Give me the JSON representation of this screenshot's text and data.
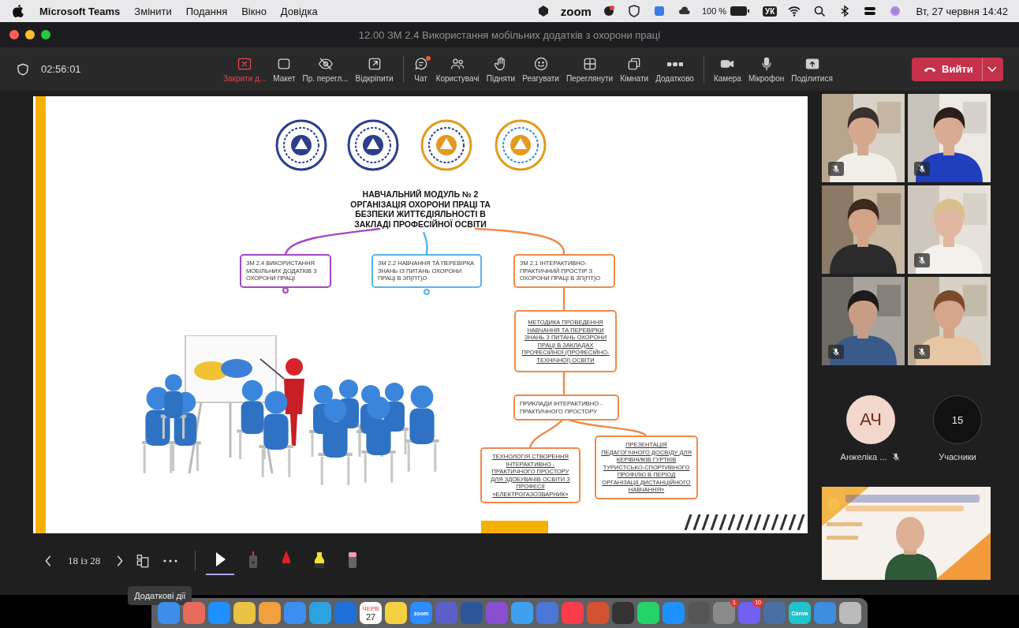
{
  "menu_bar": {
    "app": "Microsoft Teams",
    "menus": [
      "Змінити",
      "Подання",
      "Вікно",
      "Довідка"
    ],
    "zoom_label": "zoom",
    "battery": "100 %",
    "input_source": "УК",
    "clock": "Вт, 27 червня 14:42"
  },
  "window": {
    "title": "12.00 ЗМ 2.4 Використання мобільних додатків з охорони праці"
  },
  "toolbar": {
    "timer": "02:56:01",
    "leave": "Вийти",
    "buttons": [
      {
        "kind": "stop",
        "label": "Закрити д...",
        "badge": false
      },
      {
        "kind": "layout",
        "label": "Макет",
        "badge": false
      },
      {
        "kind": "eye-off",
        "label": "Пр. перегл...",
        "badge": false
      },
      {
        "kind": "popout",
        "label": "Відкріпити",
        "badge": false
      },
      {
        "kind": "chat",
        "label": "Чат",
        "badge": true
      },
      {
        "kind": "people",
        "label": "Користувачі",
        "badge": false
      },
      {
        "kind": "hand",
        "label": "Підняти",
        "badge": false
      },
      {
        "kind": "smile",
        "label": "Реагувати",
        "badge": false
      },
      {
        "kind": "grid",
        "label": "Переглянути",
        "badge": false
      },
      {
        "kind": "rooms",
        "label": "Кімнати",
        "badge": false
      },
      {
        "kind": "more",
        "label": "Додатково",
        "badge": false
      },
      {
        "kind": "camera",
        "label": "Камера",
        "badge": false
      },
      {
        "kind": "mic",
        "label": "Мікрофон",
        "badge": false
      },
      {
        "kind": "share",
        "label": "Поділитися",
        "badge": false
      }
    ]
  },
  "slide": {
    "title": "НАВЧАЛЬНИЙ МОДУЛЬ № 2 ОРГАНІЗАЦІЯ ОХОРОНИ ПРАЦІ ТА БЕЗПЕКИ ЖИТТЄДІЯЛЬНОСТІ В ЗАКЛАДІ ПРОФЕСІЙНОЇ ОСВІТИ",
    "nodes": [
      {
        "text": "ЗМ 2.4 ВИКОРИСТАННЯ МОБІЛЬНИХ ДОДАТКІВ З ОХОРОНИ ПРАЦІ",
        "color": "#a347c7",
        "underlined": false
      },
      {
        "text": "ЗМ 2.2 НАВЧАННЯ ТА ПЕРЕВІРКА ЗНАНЬ ІЗ ПИТАНЬ ОХОРОНИ ПРАЦІ В ЗП(ПТ)О",
        "color": "#5ab4ec",
        "underlined": false
      },
      {
        "text": "ЗМ 2.1 ІНТЕРАКТИВНО-ПРАКТИЧНИЙ ПРОСТІР З ОХОРОНИ ПРАЦІ В ЗП(ПТ)О",
        "color": "#f08a4b",
        "underlined": false
      },
      {
        "text": "МЕТОДИКА ПРОВЕДЕННЯ НАВЧАННЯ ТА ПЕРЕВІРКИ ЗНАНЬ З ПИТАНЬ ОХОРОНИ ПРАЦІ В ЗАКЛАДАХ ПРОФЕСІЙНОЇ (ПРОФЕСІЙНО-ТЕХНІЧНОЇ) ОСВІТИ",
        "color": "#f08a4b",
        "underlined": true
      },
      {
        "text": "ПРИКЛАДИ ІНТЕРАКТИВНО - ПРАКТИЧНОГО ПРОСТОРУ",
        "color": "#f08a4b",
        "underlined": false
      },
      {
        "text": "ТЕХНОЛОГІЯ СТВОРЕННЯ ІНТЕРАКТИВНО - ПРАКТИЧНОГО ПРОСТОРУ ДЛЯ ЗДОБУВАЧІВ ОСВІТИ З ПРОФЕСІЇ «ЕЛЕКТРОГАЗОЗВАРНИК»",
        "color": "#f08a4b",
        "underlined": true
      },
      {
        "text": "ПРЕЗЕНТАЦІЯ ПЕДАГОГІЧНОГО ДОСВІДУ ДЛЯ КЕРІВНИКІВ ГУРТКІВ ТУРИСТСЬКО-СПОРТИВНОГО ПРОФІЛЮ В ПЕРІОД ОРГАНІЗАЦІЇ ДИСТАНЦІЙНОГО НАВЧАННЯ»",
        "color": "#f08a4b",
        "underlined": true
      }
    ]
  },
  "slide_controls": {
    "page": "18 із 28",
    "tooltip": "Додаткові дії",
    "tools": [
      {
        "kind": "pointer",
        "selected": true
      },
      {
        "kind": "laser",
        "selected": false
      },
      {
        "kind": "pen",
        "selected": false
      },
      {
        "kind": "highlighter",
        "selected": false
      },
      {
        "kind": "eraser",
        "selected": false
      }
    ]
  },
  "participants": {
    "tiles": [
      {
        "muted": true
      },
      {
        "muted": true
      },
      {
        "muted": false
      },
      {
        "muted": true
      },
      {
        "muted": true
      },
      {
        "muted": true
      }
    ],
    "avatar": {
      "initials": "АЧ",
      "name": "Анжеліка ...",
      "muted": true
    },
    "count": {
      "value": "15",
      "label": "Учасники"
    }
  },
  "dock": {
    "items": [
      {
        "color": "#3d8ee8"
      },
      {
        "color": "#e86a5a"
      },
      {
        "color": "#1e90ff"
      },
      {
        "color": "#e9c341"
      },
      {
        "color": "#f2a03d"
      },
      {
        "color": "#3c8ef0"
      },
      {
        "color": "#2aa3e0"
      },
      {
        "color": "#1e6fd9"
      },
      {
        "color": "#ffffff",
        "text": "27",
        "month": "ЧЕРВ"
      },
      {
        "color": "#f5d142"
      },
      {
        "color": "#2d8cff",
        "text": "zoom"
      },
      {
        "color": "#5b5fc7"
      },
      {
        "color": "#2b579a"
      },
      {
        "color": "#8a4fd1"
      },
      {
        "color": "#40a0f0"
      },
      {
        "color": "#4c77d6"
      },
      {
        "color": "#fa3c4c"
      },
      {
        "color": "#d35230"
      },
      {
        "color": "#333333"
      },
      {
        "color": "#25d366"
      },
      {
        "color": "#1e90ff"
      },
      {
        "color": "#555555"
      },
      {
        "color": "#8a8a8a",
        "badge": "1"
      },
      {
        "color": "#7360f2",
        "badge": "10"
      },
      {
        "color": "#4a6fa5"
      },
      {
        "color": "#20c4cb",
        "text": "Canva"
      },
      {
        "color": "#3b8ee0"
      },
      {
        "color": "#bbbbbb"
      }
    ]
  }
}
